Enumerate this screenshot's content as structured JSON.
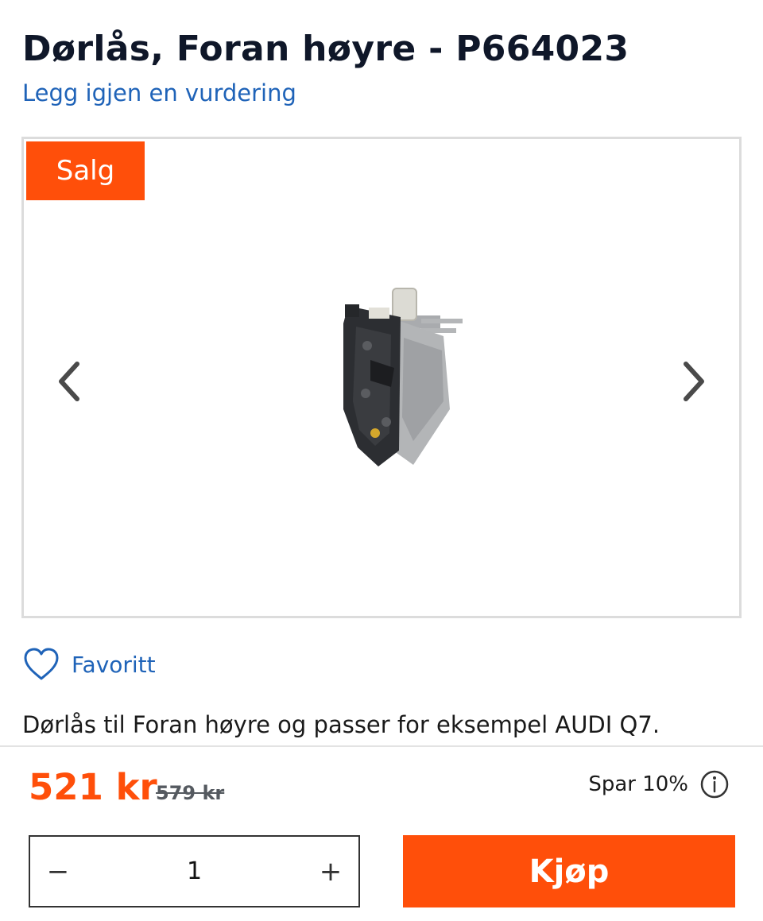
{
  "product": {
    "title": "Dørlås, Foran høyre - P664023",
    "review_link": "Legg igjen en vurdering",
    "description": "Dørlås til Foran høyre og passer for eksempel AUDI Q7."
  },
  "gallery": {
    "badge": "Salg",
    "prev_icon": "chevron-left-icon",
    "next_icon": "chevron-right-icon"
  },
  "favorite": {
    "label": "Favoritt",
    "icon": "heart-icon"
  },
  "pricing": {
    "price": "521 kr",
    "old_price": "579 kr",
    "savings": "Spar 10%",
    "info_icon": "info-icon"
  },
  "purchase": {
    "minus": "−",
    "quantity": "1",
    "plus": "+",
    "buy_label": "Kjøp"
  },
  "colors": {
    "accent": "#ff4f0a",
    "link": "#1f63b8",
    "title": "#0f1729"
  }
}
